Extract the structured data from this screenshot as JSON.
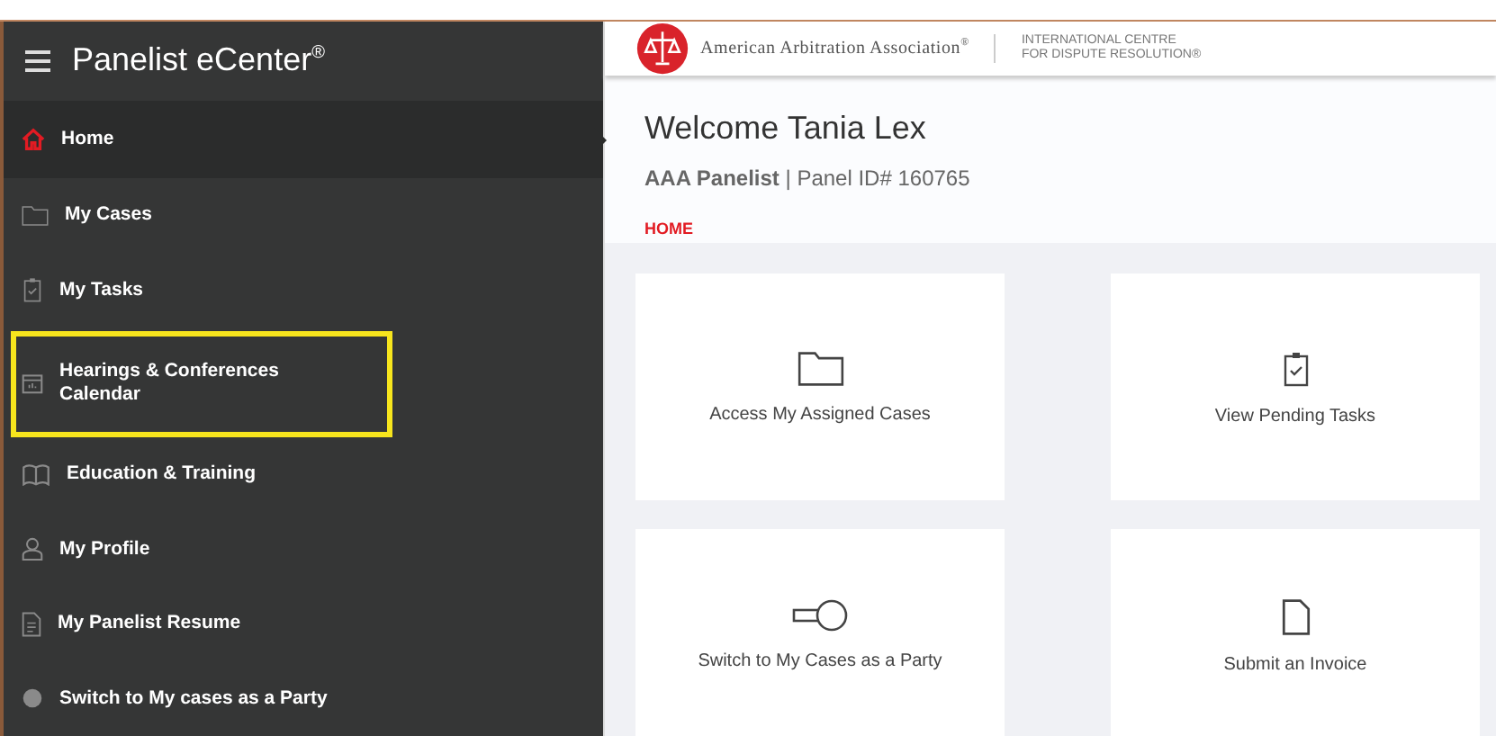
{
  "sidebar": {
    "title": "Panelist eCenter",
    "title_mark": "®",
    "items": [
      {
        "label": "Home",
        "kind": "home",
        "selected": true,
        "highlighted": false
      },
      {
        "label": "My Cases",
        "kind": "folder",
        "selected": false,
        "highlighted": false
      },
      {
        "label": "My Tasks",
        "kind": "clipboard",
        "selected": false,
        "highlighted": false
      },
      {
        "label": "Hearings & Conferences Calendar",
        "kind": "calendar",
        "selected": false,
        "highlighted": true
      },
      {
        "label": "Education & Training",
        "kind": "book",
        "selected": false,
        "highlighted": false
      },
      {
        "label": "My Profile",
        "kind": "person",
        "selected": false,
        "highlighted": false
      },
      {
        "label": "My Panelist Resume",
        "kind": "document",
        "selected": false,
        "highlighted": false
      },
      {
        "label": "Switch to My cases as a Party",
        "kind": "circle",
        "selected": false,
        "highlighted": false
      }
    ]
  },
  "header": {
    "org_name": "American Arbitration Association",
    "org_mark": "®",
    "centre_line_1": "INTERNATIONAL CENTRE",
    "centre_line_2": "FOR DISPUTE RESOLUTION®"
  },
  "welcome": {
    "heading": "Welcome Tania Lex",
    "role": "AAA Panelist",
    "panel_id": "| Panel ID# 160765",
    "breadcrumb": "HOME"
  },
  "cards": [
    {
      "label": "Access My Assigned Cases",
      "kind": "folder"
    },
    {
      "label": "View Pending Tasks",
      "kind": "clipboard"
    },
    {
      "label": "Switch to My Cases as a Party",
      "kind": "key"
    },
    {
      "label": "Submit an Invoice",
      "kind": "document"
    }
  ]
}
